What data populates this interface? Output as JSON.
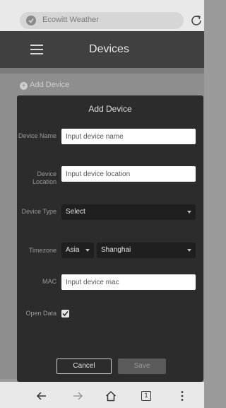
{
  "browser": {
    "url_text": "Ecowitt Weather",
    "url_icon": "shield-icon",
    "reload_icon": "reload-icon"
  },
  "header": {
    "menu_icon": "hamburger-menu-icon",
    "title": "Devices"
  },
  "page": {
    "add_device_link": "Add Device",
    "add_icon": "plus-circle-icon"
  },
  "modal": {
    "title": "Add Device",
    "device_name": {
      "label": "Device Name",
      "placeholder": "Input device name",
      "value": ""
    },
    "device_location": {
      "label": "Device Location",
      "placeholder": "Input device location",
      "value": ""
    },
    "device_type": {
      "label": "Device Type",
      "selected": "Select"
    },
    "timezone": {
      "label": "Timezone",
      "region": "Asia",
      "city": "Shanghai"
    },
    "mac": {
      "label": "MAC",
      "placeholder": "Input device mac",
      "value": ""
    },
    "open_data": {
      "label": "Open Data",
      "checked": true
    },
    "cancel_label": "Cancel",
    "save_label": "Save"
  },
  "nav": {
    "back_icon": "back-arrow-icon",
    "forward_icon": "forward-arrow-icon",
    "home_icon": "home-icon",
    "tabs_count": "1",
    "overflow_icon": "overflow-menu-icon"
  },
  "colors": {
    "overlay_background": "#8e8e8e",
    "modal_background": "#2c2c2c",
    "header_background": "#404040",
    "input_background": "#ffffff",
    "select_background": "#1f1f1f"
  }
}
